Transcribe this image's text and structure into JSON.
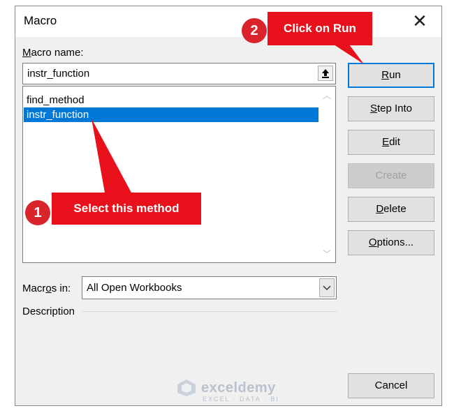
{
  "dialog": {
    "title": "Macro",
    "macro_name_label_access": "M",
    "macro_name_label_rest": "acro name:",
    "macro_name_value": "instr_function",
    "macros": [
      "find_method",
      "instr_function"
    ],
    "selected_index": 1,
    "macros_in_label_pre": "Macr",
    "macros_in_label_access": "o",
    "macros_in_label_post": "s in:",
    "macros_in_value": "All Open Workbooks",
    "description_label": "Description"
  },
  "buttons": {
    "run": {
      "access": "R",
      "rest": "un"
    },
    "step_into": {
      "access": "S",
      "rest": "tep Into"
    },
    "edit": {
      "access": "E",
      "rest": "dit"
    },
    "create": "Create",
    "delete": {
      "access": "D",
      "rest": "elete"
    },
    "options": {
      "access": "O",
      "rest": "ptions..."
    },
    "cancel": "Cancel"
  },
  "annotations": {
    "step1_number": "1",
    "step1_text": "Select this method",
    "step2_number": "2",
    "step2_text": "Click on Run"
  },
  "watermark": {
    "title": "exceldemy",
    "subtitle": "EXCEL · DATA · BI"
  },
  "colors": {
    "selection": "#0078d7",
    "callout": "#e8101a",
    "badge": "#d9242b"
  }
}
